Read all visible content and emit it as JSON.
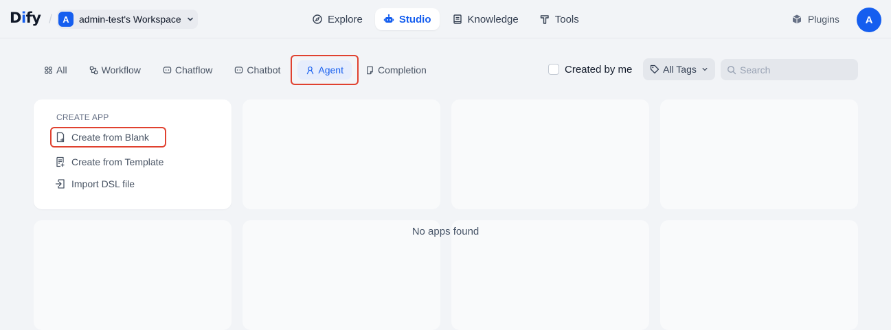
{
  "brand": {
    "logo_text_a": "D",
    "logo_text_b": "i",
    "logo_text_c": "fy"
  },
  "workspace": {
    "avatar_letter": "A",
    "name": "admin-test's Workspace"
  },
  "nav": {
    "items": [
      {
        "label": "Explore",
        "icon": "compass-icon"
      },
      {
        "label": "Studio",
        "icon": "robot-icon",
        "active": true
      },
      {
        "label": "Knowledge",
        "icon": "book-icon"
      },
      {
        "label": "Tools",
        "icon": "hammer-icon"
      }
    ]
  },
  "plugins": {
    "label": "Plugins",
    "icon": "cube-icon"
  },
  "user": {
    "avatar_letter": "A"
  },
  "filters": {
    "tabs": [
      {
        "label": "All",
        "icon": "grid-icon"
      },
      {
        "label": "Workflow",
        "icon": "workflow-icon"
      },
      {
        "label": "Chatflow",
        "icon": "chat-bubble-icon"
      },
      {
        "label": "Chatbot",
        "icon": "chatbot-icon"
      },
      {
        "label": "Agent",
        "icon": "agent-icon",
        "active": true
      },
      {
        "label": "Completion",
        "icon": "document-icon"
      }
    ],
    "created_by_me": {
      "label": "Created by me",
      "checked": false
    },
    "tags": {
      "label": "All Tags"
    },
    "search": {
      "placeholder": "Search",
      "value": ""
    }
  },
  "create_app": {
    "title": "CREATE APP",
    "items": [
      {
        "label": "Create from Blank",
        "icon": "file-plus-icon"
      },
      {
        "label": "Create from Template",
        "icon": "template-icon"
      },
      {
        "label": "Import DSL file",
        "icon": "import-icon"
      }
    ]
  },
  "empty_state": {
    "message": "No apps found"
  },
  "colors": {
    "accent": "#155eef",
    "highlight": "#e0412f",
    "background": "#f2f4f7"
  }
}
